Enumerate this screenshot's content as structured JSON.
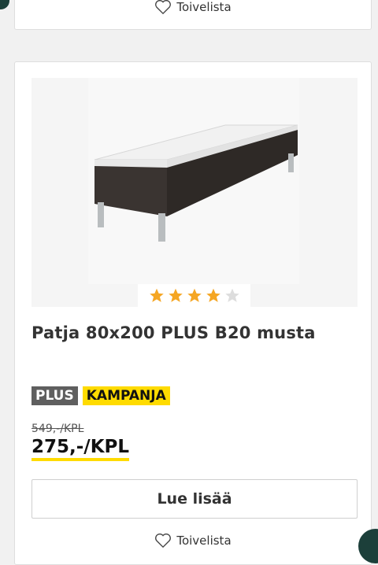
{
  "top_card": {
    "wishlist_label": "Toivelista"
  },
  "product": {
    "image_alt": "product-image",
    "rating": {
      "value": 4,
      "max": 5,
      "filled_color": "#f5a623",
      "empty_color": "#dddddd"
    },
    "title": "Patja 80x200 PLUS B20 musta",
    "badges": {
      "plus": "PLUS",
      "kampanja": "KAMPANJA"
    },
    "old_price": "549,-/KPL",
    "new_price": "275,-/KPL",
    "read_more_label": "Lue lisää",
    "wishlist_label": "Toivelista"
  },
  "colors": {
    "accent_yellow": "#ffdb00",
    "badge_gray": "#5f5f5f"
  }
}
